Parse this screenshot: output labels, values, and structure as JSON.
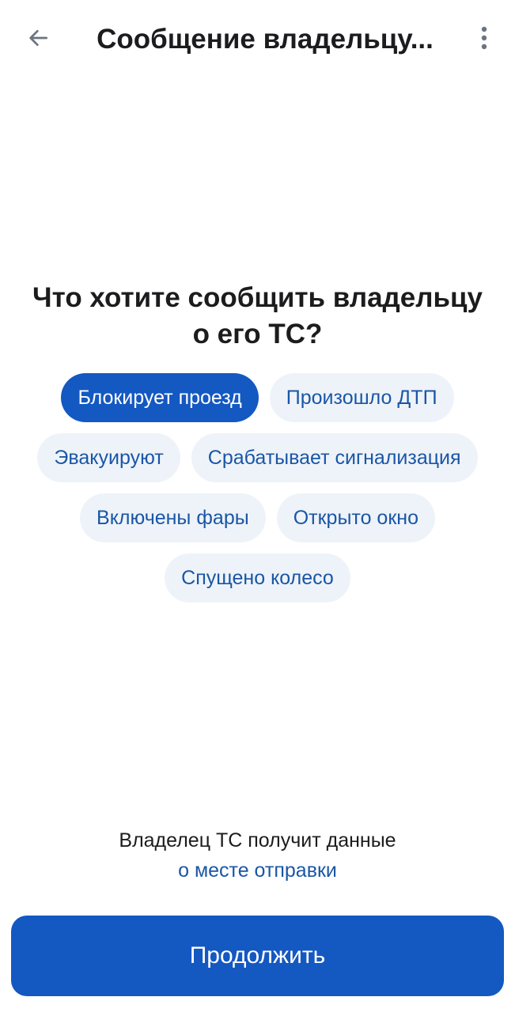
{
  "header": {
    "title": "Сообщение владельцу...",
    "back_icon": "arrow-left-icon",
    "menu_icon": "more-vertical-icon"
  },
  "question": {
    "line1": "Что хотите сообщить владельцу",
    "line2": "о его ТС?"
  },
  "options": {
    "row1": [
      "Блокирует проезд",
      "Произошло ДТП"
    ],
    "row2": [
      "Эвакуируют",
      "Срабатывает сигнализация"
    ],
    "row3": [
      "Включены фары",
      "Открыто окно"
    ],
    "row4": [
      "Спущено колесо"
    ],
    "selected": "Блокирует проезд"
  },
  "info": {
    "text": "Владелец ТС получит данные",
    "link": "о месте отправки"
  },
  "actions": {
    "continue_label": "Продолжить"
  },
  "colors": {
    "accent": "#1458c2",
    "chip_bg": "#eef3f9",
    "chip_text": "#1a56a6",
    "text": "#1c1c1e"
  }
}
